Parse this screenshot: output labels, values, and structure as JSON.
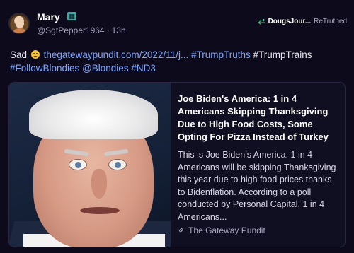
{
  "author": {
    "display_name": "Mary",
    "handle": "@SgtPepper1964",
    "separator": "·",
    "time": "13h"
  },
  "retruth": {
    "user": "DougsJour...",
    "label": "ReTruthed"
  },
  "post": {
    "word_sad": "Sad",
    "link": "thegatewaypundit.com/2022/11/j...",
    "tag_trumptruths": "#TrumpTruths",
    "tag_trumptrains": "#TrumpTrains",
    "tag_followblondies": "#FollowBlondies",
    "mention_blondies": "@Blondies",
    "tag_nd3": "#ND3"
  },
  "card": {
    "title": "Joe Biden's America: 1 in 4 Americans Skipping Thanksgiving Due to High Food Costs, Some Opting For Pizza Instead of Turkey",
    "description": "This is Joe Biden’s America. 1 in 4 Americans will be skipping Thanksgiving this year due to high food prices thanks to Bidenflation. According to a poll conducted by Personal Capital, 1 in 4 Americans...",
    "source": "The Gateway Pundit"
  },
  "icons": {
    "bot_badge": "robot-badge-icon",
    "retruth": "retruth-icon",
    "emoji": "sad-face-emoji-icon",
    "link": "link-icon"
  },
  "colors": {
    "background": "#0c0a1b",
    "link": "#7fa6ff",
    "retruth_icon": "#5fc4a0",
    "badge": "#3aa7a0"
  }
}
